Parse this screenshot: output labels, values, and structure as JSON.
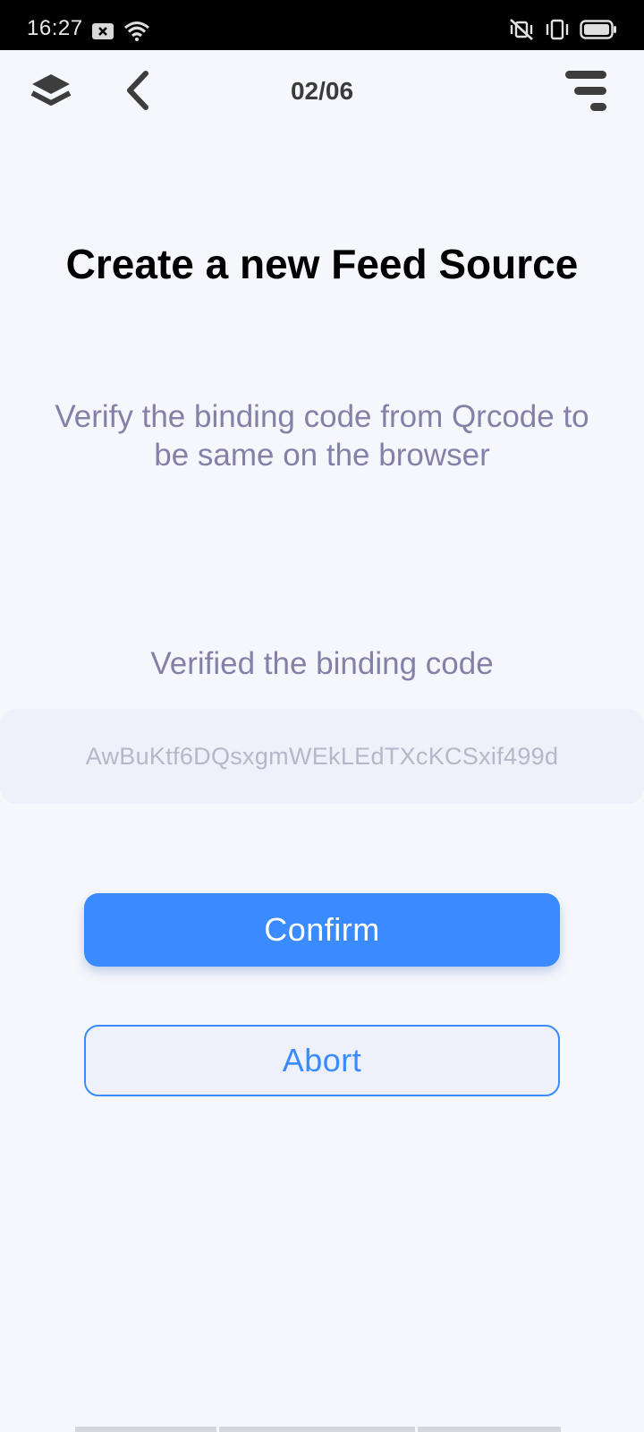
{
  "status_bar": {
    "time": "16:27",
    "left_icons": [
      "notification-x-icon",
      "wifi-icon"
    ],
    "right_icons": [
      "vibrate-mute-icon",
      "vibrate-icon",
      "battery-icon"
    ]
  },
  "header": {
    "page_counter": "02/06",
    "icons": [
      "layers-icon",
      "back-chevron-icon",
      "menu-icon"
    ]
  },
  "main": {
    "title": "Create a new Feed Source",
    "instruction_line1": "Verify the binding code from Qrcode to",
    "instruction_line2": "be same on the browser",
    "section_label": "Verified the binding code",
    "binding_code": "AwBuKtf6DQsxgmWEkLEdTXcKCSxif499d"
  },
  "actions": {
    "confirm_label": "Confirm",
    "abort_label": "Abort"
  },
  "colors": {
    "accent": "#3a8bff",
    "background": "#f6f7fc",
    "muted_text": "#8680a8",
    "field_background": "#eef0fa"
  }
}
